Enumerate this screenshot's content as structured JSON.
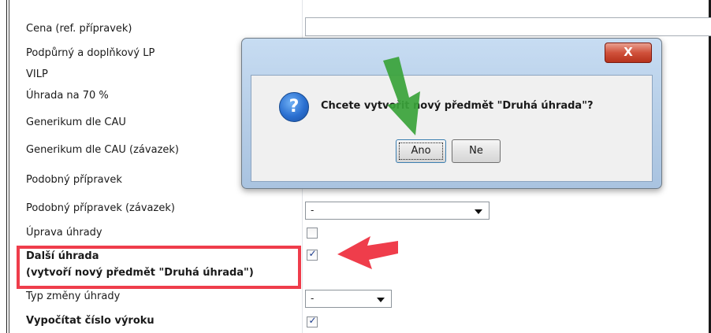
{
  "form": {
    "rows": [
      {
        "label": "Cena (ref. přípravek)"
      },
      {
        "label": "Podpůrný a doplňkový LP"
      },
      {
        "label": "VILP"
      },
      {
        "label": "Úhrada na 70 %"
      },
      {
        "label": "Generikum dle CAU"
      },
      {
        "label": "Generikum dle CAU (závazek)"
      },
      {
        "label": "Podobný přípravek"
      },
      {
        "label": "Podobný přípravek (závazek)"
      },
      {
        "label": "Úprava úhrady"
      },
      {
        "label": "Další úhrada"
      },
      {
        "label": "(vytvoří nový předmět \"Druhá úhrada\")"
      },
      {
        "label": "Typ změny úhrady"
      },
      {
        "label": "Vypočítat číslo výroku"
      }
    ],
    "podobny_zavazek_value": "-",
    "typ_zmeny_value": "-",
    "uprava_uhrady_checked": false,
    "dalsi_uhrada_checked": true,
    "vypocitat_checked": true,
    "check_mark": "✓"
  },
  "dialog": {
    "close_label": "X",
    "icon": "question-icon",
    "icon_glyph": "?",
    "message": "Chcete vytvořit nový předmět \"Druhá úhrada\"?",
    "yes_label": "Ano",
    "no_label": "Ne"
  },
  "annotations": {
    "red_arrow_color": "#ef3d4b",
    "green_arrow_color": "#3aa33a",
    "highlight_color": "#ef3d4b"
  }
}
